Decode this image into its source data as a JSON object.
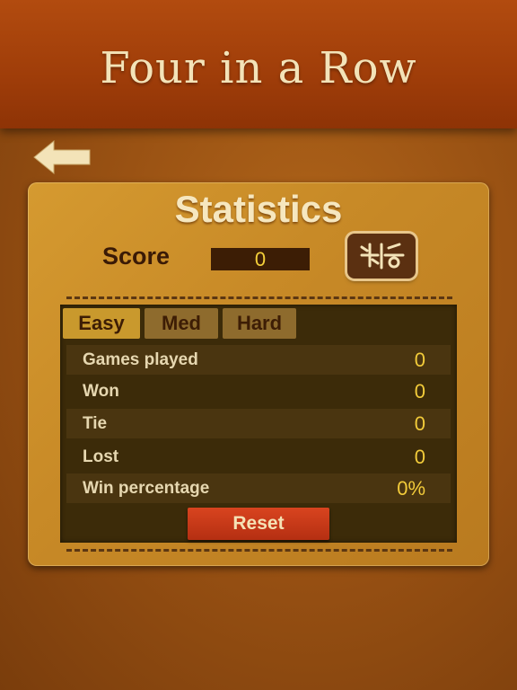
{
  "header": {
    "title": "Four in a Row"
  },
  "nav": {
    "back_icon": "left-arrow-icon"
  },
  "stats": {
    "title": "Statistics",
    "score_label": "Score",
    "score_value": "0",
    "share_icon": "game-logo-icon"
  },
  "tabs": [
    {
      "label": "Easy",
      "active": true
    },
    {
      "label": "Med",
      "active": false
    },
    {
      "label": "Hard",
      "active": false
    }
  ],
  "rows": [
    {
      "label": "Games played",
      "value": "0"
    },
    {
      "label": "Won",
      "value": "0"
    },
    {
      "label": "Tie",
      "value": "0"
    },
    {
      "label": "Lost",
      "value": "0"
    },
    {
      "label": "Win percentage",
      "value": "0%"
    }
  ],
  "reset_label": "Reset",
  "colors": {
    "header": "#a9440c",
    "panel": "#c98b28",
    "board": "#3c2b09",
    "value_yellow": "#f2cb3a",
    "reset_red": "#c93a18"
  }
}
